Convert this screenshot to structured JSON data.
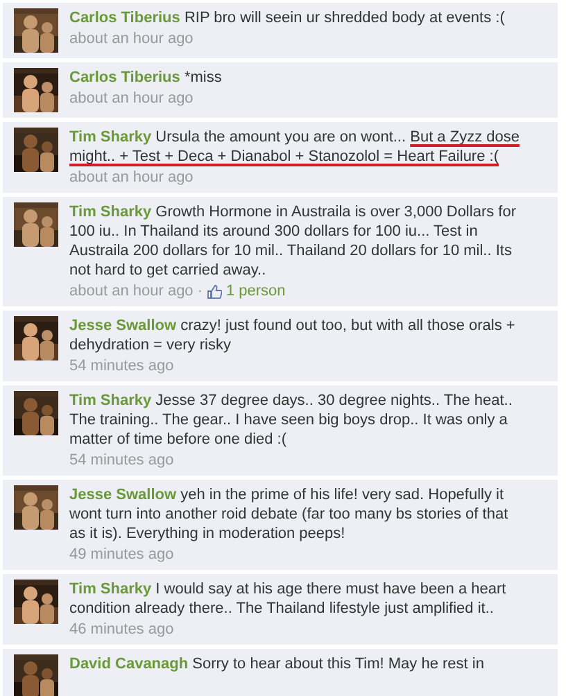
{
  "comments": [
    {
      "author": "Carlos Tiberius",
      "text": "RIP bro will seein ur shredded body at events :(",
      "time": "about an hour ago"
    },
    {
      "author": "Carlos Tiberius",
      "text": "*miss",
      "time": "about an hour ago"
    },
    {
      "author": "Tim Sharky",
      "text": "Ursula the amount you are on wont...",
      "underlined": "But a Zyzz dose might.. + Test + Deca + Dianabol + Stanozolol = Heart Failure :(",
      "time": "about an hour ago"
    },
    {
      "author": "Tim Sharky",
      "text": "Growth Hormone in Austraila is over 3,000 Dollars for 100 iu.. In Thailand its around 300 dollars for 100 iu... Test in Austraila 200 dollars for 10 mil.. Thailand 20 dollars for 10 mil.. Its not hard to get carried away..",
      "time": "about an hour ago",
      "separator": "·",
      "likes": "1 person"
    },
    {
      "author": "Jesse Swallow",
      "text": "crazy! just found out too, but with all those orals + dehydration = very risky",
      "time": "54 minutes ago"
    },
    {
      "author": "Tim Sharky",
      "text": "Jesse 37 degree days.. 30 degree nights.. The heat.. The training.. The gear.. I have seen big boys drop.. It was only a matter of time before one died :(",
      "time": "54 minutes ago"
    },
    {
      "author": "Jesse Swallow",
      "text": "yeh in the prime of his life! very sad. Hopefully it wont turn into another roid debate (far too many bs stories of that as it is). Everything in moderation peeps!",
      "time": "49 minutes ago"
    },
    {
      "author": "Tim Sharky",
      "text": "I would say at his age there must have been a heart condition already there.. The Thailand lifestyle just amplified it..",
      "time": "46 minutes ago"
    },
    {
      "author": "David Cavanagh",
      "text": "Sorry to hear about this Tim! May he rest in"
    }
  ]
}
